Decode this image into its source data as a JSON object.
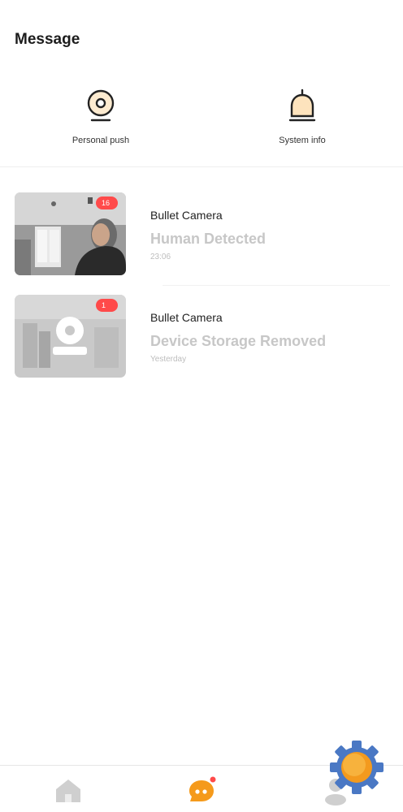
{
  "header": {
    "title": "Message"
  },
  "quick_actions": [
    {
      "label": "Personal push",
      "icon": "webcam-icon"
    },
    {
      "label": "System info",
      "icon": "bell-icon"
    }
  ],
  "messages": [
    {
      "device": "Bullet Camera",
      "event": "Human Detected",
      "time": "23:06",
      "badge": "16"
    },
    {
      "device": "Bullet Camera",
      "event": "Device Storage Removed",
      "time": "Yesterday",
      "badge": "1"
    }
  ],
  "tabbar": {
    "items": [
      {
        "name": "home",
        "icon": "home-icon",
        "active": false
      },
      {
        "name": "message",
        "icon": "message-icon",
        "active": true
      },
      {
        "name": "me",
        "icon": "user-icon",
        "active": false
      }
    ]
  },
  "colors": {
    "accent": "#f59a1b",
    "badge": "#ff4a4a",
    "muted_text": "#c7c7c7",
    "fab_gear": "#4a78c4"
  }
}
